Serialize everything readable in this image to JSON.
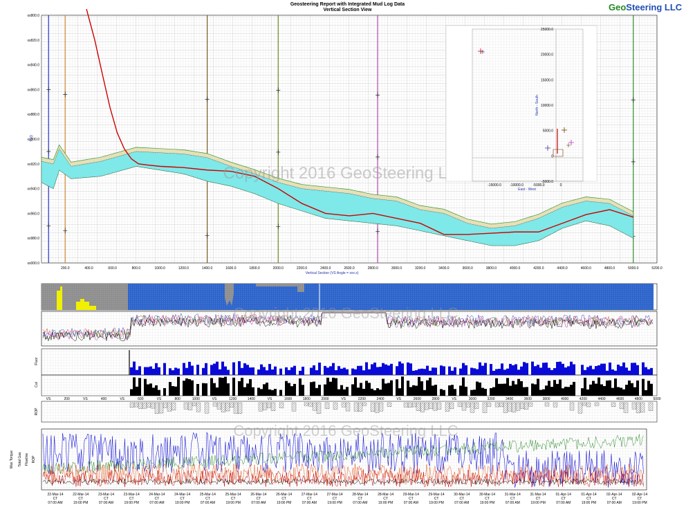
{
  "report": {
    "title": "Geosteering Report with Integrated Mud Log Data",
    "subtitle": "Vertical Section View",
    "brand_geo": "Geo",
    "brand_rest": "Steering LLC",
    "watermark": "Copyright 2016 GeoSteering LLC"
  },
  "colors": {
    "wellbore": "#cc0000",
    "target_zone": "#7fe8e8",
    "formation_fill": "#e6e0b8",
    "brand_green": "#1f8a1f",
    "lithology_blue": "#2a62c9",
    "lithology_grey": "#8e8e8e",
    "lithology_yellow": "#f0f000"
  },
  "chart_data": [
    {
      "type": "line",
      "panel": "vertical-section",
      "xlabel": "Vertical Section (VS Angle = xxx.x)",
      "ylabel": "TVD",
      "xlim": [
        0,
        5200
      ],
      "ylim": [
        3000,
        2800
      ],
      "x_ticks": [
        "200.0",
        "400.0",
        "600.0",
        "800.0",
        "1000.0",
        "1200.0",
        "1400.0",
        "1600.0",
        "1800.0",
        "2000.0",
        "2200.0",
        "2400.0",
        "2600.0",
        "2800.0",
        "3000.0",
        "3200.0",
        "3400.0",
        "3600.0",
        "3800.0",
        "4000.0",
        "4200.0",
        "4400.0",
        "4600.0",
        "4800.0",
        "5000.0",
        "5200.0"
      ],
      "y_ticks": [
        "xx800.0",
        "xx820.0",
        "xx840.0",
        "xx860.0",
        "xx880.0",
        "xx900.0",
        "xx920.0",
        "xx940.0",
        "xx960.0",
        "xx980.0",
        "xx000.0"
      ],
      "series": [
        {
          "x": [
            380,
            450,
            520,
            580,
            640,
            700,
            760,
            820,
            900,
            1000,
            1200,
            1400,
            1600,
            1800,
            2000,
            2200,
            2400,
            2600,
            2800,
            3000,
            3200,
            3400,
            3600,
            3800,
            4000,
            4200,
            4400,
            4600,
            4800,
            5000
          ],
          "y": [
            2795,
            2820,
            2850,
            2875,
            2895,
            2908,
            2916,
            2920,
            2921,
            2922,
            2923,
            2925,
            2926,
            2930,
            2940,
            2952,
            2960,
            2962,
            2960,
            2964,
            2968,
            2977,
            2977,
            2976,
            2975,
            2975,
            2968,
            2961,
            2957,
            2963
          ]
        }
      ],
      "band_top": {
        "x": [
          0,
          100,
          150,
          250,
          500,
          800,
          1000,
          1200,
          1400,
          1600,
          1800,
          2000,
          2200,
          2400,
          2600,
          2800,
          3000,
          3200,
          3400,
          3600,
          3800,
          4000,
          4200,
          4400,
          4600,
          4800,
          5000
        ],
        "y": [
          2918,
          2920,
          2908,
          2922,
          2918,
          2910,
          2911,
          2912,
          2915,
          2922,
          2928,
          2935,
          2940,
          2942,
          2944,
          2948,
          2950,
          2957,
          2960,
          2968,
          2972,
          2970,
          2964,
          2955,
          2950,
          2952,
          2962
        ]
      },
      "band_bottom": {
        "x": [
          0,
          100,
          150,
          250,
          500,
          800,
          1000,
          1200,
          1400,
          1600,
          1800,
          2000,
          2200,
          2400,
          2600,
          2800,
          3000,
          3200,
          3400,
          3600,
          3800,
          4000,
          4200,
          4400,
          4600,
          4800,
          5000
        ],
        "y": [
          2935,
          2940,
          2925,
          2932,
          2930,
          2922,
          2925,
          2928,
          2934,
          2938,
          2944,
          2952,
          2958,
          2964,
          2966,
          2968,
          2970,
          2974,
          2978,
          2982,
          2986,
          2986,
          2982,
          2972,
          2966,
          2970,
          2980
        ]
      },
      "vertical_markers_x": [
        60,
        200,
        1400,
        2000,
        2840,
        5000
      ]
    },
    {
      "type": "scatter",
      "panel": "plan-view-inset",
      "xlabel": "East - West",
      "ylabel": "North - South",
      "xlim": [
        -20000,
        5000
      ],
      "ylim": [
        -5000,
        25000
      ],
      "x_ticks": [
        "-15000.0",
        "-10000.0",
        "-5000.0",
        "0"
      ],
      "y_ticks": [
        "25000.0",
        "20000.0",
        "15000.0",
        "10000.0",
        "5000.0",
        "0",
        "-5000.0"
      ]
    },
    {
      "type": "bar",
      "panel": "lithology-tracks",
      "vs_axis_ticks": [
        "VS",
        "200",
        "VS",
        "400",
        "VS",
        "600",
        "VS",
        "800",
        "1000",
        "VS",
        "1200",
        "1400",
        "VS",
        "1600",
        "1800",
        "2000",
        "VS",
        "2200",
        "2400",
        "VS",
        "2600",
        "2800",
        "VS",
        "3000",
        "3200",
        "3400",
        "3600",
        "3800",
        "4000",
        "4200",
        "4400",
        "4600",
        "4800",
        "5000"
      ],
      "track_labels": [
        "ROP",
        "Cut",
        "Fluor"
      ]
    },
    {
      "type": "line",
      "panel": "time-log",
      "y_labels": [
        "Max Torque",
        "Total Gas",
        "Flowline",
        "ROP"
      ],
      "x_ticks": [
        [
          "22-Mar-14",
          "CT",
          "07:00 AM"
        ],
        [
          "22-Mar-14",
          "CT",
          "19:00 PM"
        ],
        [
          "23-Mar-14",
          "CT",
          "07:00 AM"
        ],
        [
          "23-Mar-14",
          "CT",
          "19:00 PM"
        ],
        [
          "24-Mar-14",
          "CT",
          "07:00 AM"
        ],
        [
          "24-Mar-14",
          "CT",
          "19:00 PM"
        ],
        [
          "25-Mar-14",
          "CT",
          "07:00 AM"
        ],
        [
          "25-Mar-14",
          "CT",
          "19:00 PM"
        ],
        [
          "26-Mar-14",
          "CT",
          "07:00 AM"
        ],
        [
          "26-Mar-14",
          "CT",
          "19:00 PM"
        ],
        [
          "27-Mar-14",
          "CT",
          "07:00 AM"
        ],
        [
          "27-Mar-14",
          "CT",
          "19:00 PM"
        ],
        [
          "28-Mar-14",
          "CT",
          "07:00 AM"
        ],
        [
          "28-Mar-14",
          "CT",
          "19:00 PM"
        ],
        [
          "29-Mar-14",
          "CT",
          "07:00 AM"
        ],
        [
          "29-Mar-14",
          "CT",
          "19:00 PM"
        ],
        [
          "30-Mar-14",
          "CT",
          "07:00 AM"
        ],
        [
          "30-Mar-14",
          "CT",
          "19:00 PM"
        ],
        [
          "31-Mar-14",
          "CT",
          "07:00 AM"
        ],
        [
          "31-Mar-14",
          "CT",
          "19:00 PM"
        ],
        [
          "01-Apr-14",
          "CT",
          "07:00 AM"
        ],
        [
          "01-Apr-14",
          "CT",
          "19:00 PM"
        ],
        [
          "02-Apr-14",
          "CT",
          "07:00 AM"
        ],
        [
          "02-Apr-14",
          "CT",
          "19:00 PM"
        ]
      ]
    }
  ]
}
